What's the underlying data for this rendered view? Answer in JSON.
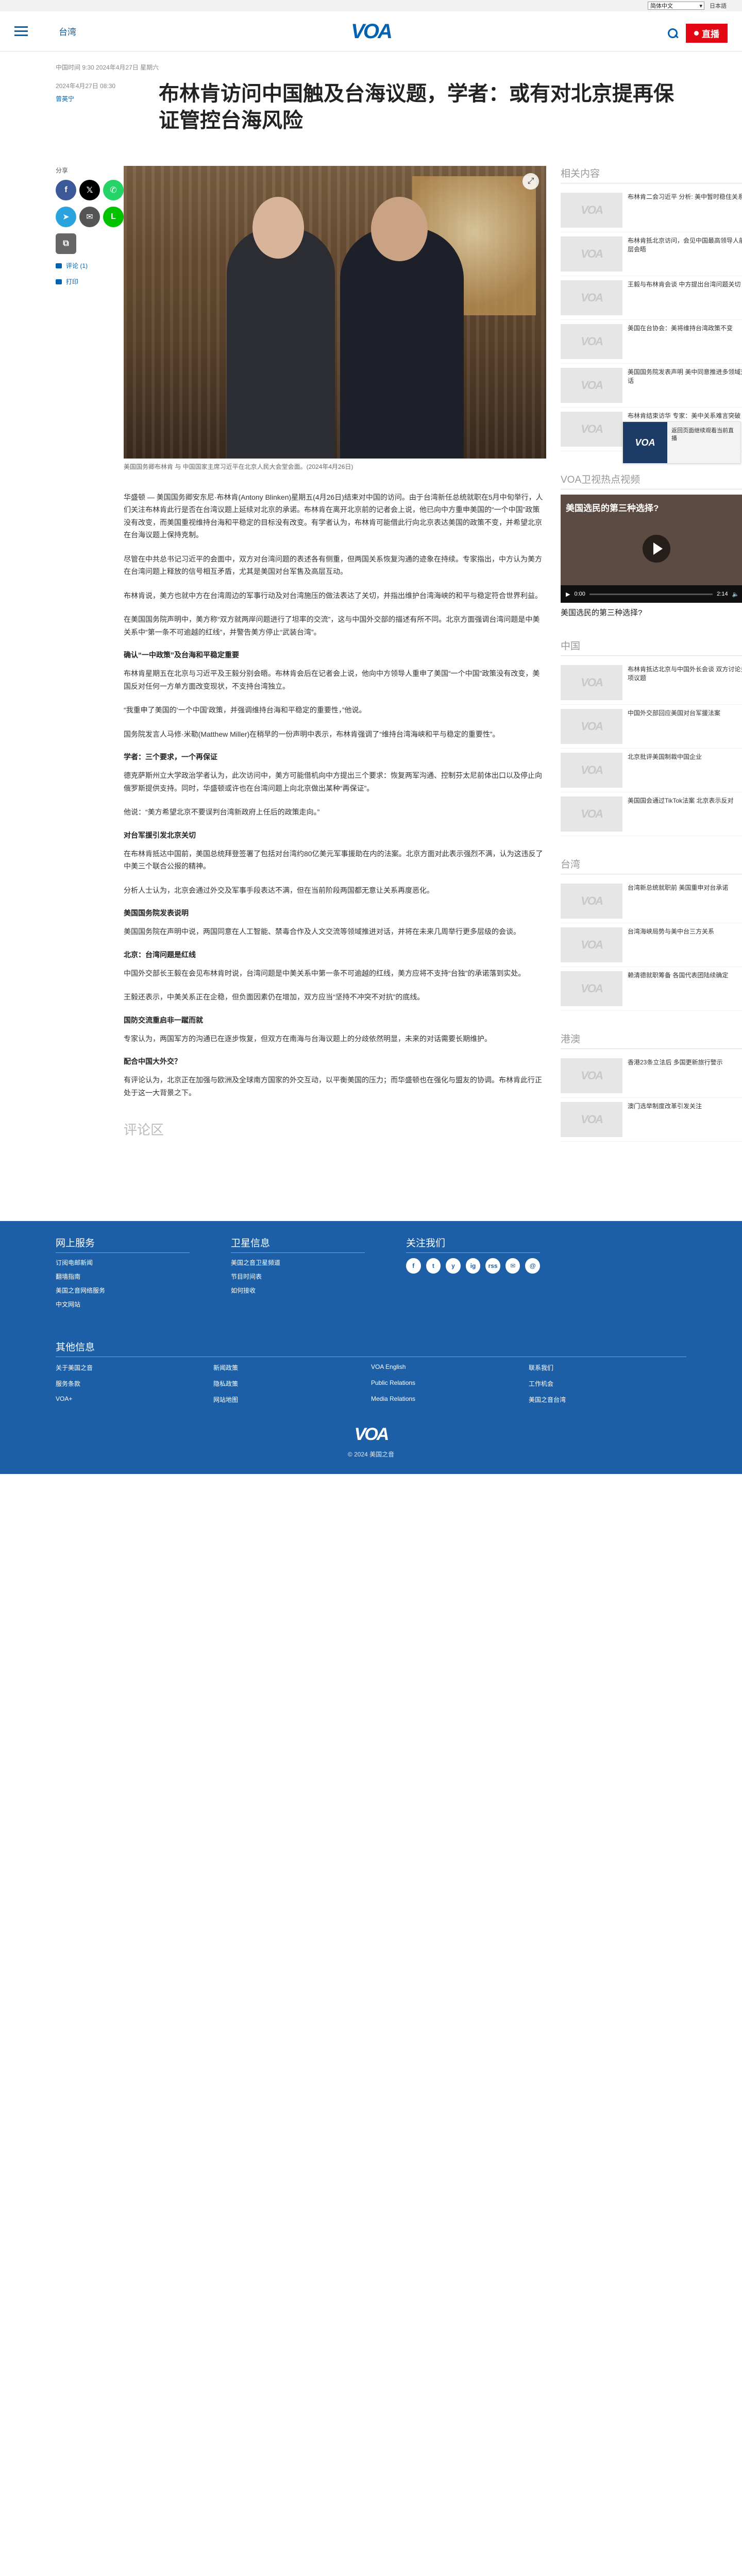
{
  "topbar": {
    "language": "简体中文",
    "external_link": "日本語"
  },
  "header": {
    "section": "台湾",
    "logo": "VOA",
    "live_label": "直播"
  },
  "article": {
    "updated": "中国时间 9:30 2024年4月27日 星期六",
    "date": "2024年4月27日 08:30",
    "author": "曾英宁",
    "title": "布林肯访问中国触及台海议题，学者：或有对北京提再保证管控台海风险",
    "caption": "美国国务卿布林肯 与 中国国家主席习近平在北京人民大会堂会面。(2024年4月26日)",
    "paragraphs": [
      "华盛顿 — 美国国务卿安东尼·布林肯(Antony Blinken)星期五(4月26日)结束对中国的访问。由于台湾新任总统就职在5月中旬举行，人们关注布林肯此行是否在台湾议题上延续对北京的承诺。布林肯在离开北京前的记者会上说，他已向中方重申美国的“一个中国”政策没有改变，而美国重视维持台海和平稳定的目标没有改变。有学者认为，布林肯可能借此行向北京表达美国的政策不变，并希望北京在台海议题上保持克制。",
      "尽管在中共总书记习近平的会面中，双方对台湾问题的表述各有侧重，但两国关系恢复沟通的迹象在持续。专家指出，中方认为美方在台湾问题上释放的信号相互矛盾，尤其是美国对台军售及高层互动。",
      "布林肯说，美方也就中方在台湾周边的军事行动及对台湾施压的做法表达了关切，并指出维护台湾海峡的和平与稳定符合世界利益。",
      "在美国国务院声明中，美方称“双方就两岸问题进行了坦率的交流”，这与中国外交部的描述有所不同。北京方面强调台湾问题是中美关系中“第一条不可逾越的红线”，并警告美方停止“武装台湾”。"
    ],
    "sections": [
      {
        "heading": "确认“一中政策”及台海和平稳定重要",
        "paragraphs": [
          "布林肯星期五在北京与习近平及王毅分别会晤。布林肯会后在记者会上说，他向中方领导人重申了美国“一个中国”政策没有改变，美国反对任何一方单方面改变现状，不支持台湾独立。",
          "“我重申了美国的‘一个中国’政策，并强调维持台海和平稳定的重要性，”他说。",
          "国务院发言人马修·米勒(Matthew Miller)在稍早的一份声明中表示，布林肯强调了“维持台湾海峡和平与稳定的重要性”。"
        ]
      },
      {
        "heading": "学者：三个要求，一个再保证",
        "paragraphs": [
          "德克萨斯州立大学政治学者认为，此次访问中，美方可能借机向中方提出三个要求：恢复两军沟通、控制芬太尼前体出口以及停止向俄罗斯提供支持。同时，华盛顿或许也在台湾问题上向北京做出某种“再保证”。",
          "他说：“美方希望北京不要误判台湾新政府上任后的政策走向。”"
        ]
      },
      {
        "heading": "对台军援引发北京关切",
        "paragraphs": [
          "在布林肯抵达中国前，美国总统拜登签署了包括对台湾约80亿美元军事援助在内的法案。北京方面对此表示强烈不满，认为这违反了中美三个联合公报的精神。",
          "分析人士认为，北京会通过外交及军事手段表达不满，但在当前阶段两国都无意让关系再度恶化。"
        ]
      },
      {
        "heading": "美国国务院发表说明",
        "paragraphs": [
          "美国国务院在声明中说，两国同意在人工智能、禁毒合作及人文交流等领域推进对话，并将在未来几周举行更多层级的会谈。"
        ]
      },
      {
        "heading": "北京：台湾问题是红线",
        "paragraphs": [
          "中国外交部长王毅在会见布林肯时说，台湾问题是中美关系中第一条不可逾越的红线，美方应将不支持“台独”的承诺落到实处。",
          "王毅还表示，中美关系正在企稳，但负面因素仍在增加，双方应当“坚持不冲突不对抗”的底线。"
        ]
      },
      {
        "heading": "国防交流重启非一蹴而就",
        "paragraphs": [
          "专家认为，两国军方的沟通已在逐步恢复，但双方在南海与台海议题上的分歧依然明显，未来的对话需要长期维护。"
        ]
      },
      {
        "heading": "配合中国大外交？",
        "paragraphs": [
          "有评论认为，北京正在加强与欧洲及全球南方国家的外交互动，以平衡美国的压力；而华盛顿也在强化与盟友的协调。布林肯此行正处于这一大背景之下。"
        ]
      }
    ]
  },
  "share": {
    "label": "分享",
    "comments": "评论 (1)",
    "print": "打印"
  },
  "sidebar": {
    "related": {
      "title": "相关内容",
      "items": [
        "布林肯二会习近平 分析: 美中暂时稳住关系",
        "布林肯抵北京访问，会见中国最高领导人前高层会晤",
        "王毅与布林肯会谈 中方提出台湾问题关切",
        "美国在台协会：美将维持台湾政策不变",
        "美国国务院发表声明 美中同意推进多领域对话",
        "布林肯结束访华 专家：美中关系难言突破"
      ]
    },
    "video": {
      "section_title": "VOA卫视热点视频",
      "overlay_title": "美国选民的第三种选择?",
      "time": "0:00",
      "duration": "2:14",
      "caption": "美国选民的第三种选择?"
    },
    "china": {
      "title": "中国",
      "items": [
        "布林肯抵达北京与中国外长会谈 双方讨论多项议题",
        "中国外交部回应美国对台军援法案",
        "北京批评美国制裁中国企业",
        "美国国会通过TikTok法案 北京表示反对"
      ]
    },
    "taiwan": {
      "title": "台湾",
      "items": [
        "台湾新总统就职前 美国重申对台承诺",
        "台湾海峡局势与美中台三方关系",
        "赖清德就职筹备 各国代表团陆续确定"
      ]
    },
    "hongkong": {
      "title": "港澳",
      "items": [
        "香港23条立法后 多国更新旅行警示",
        "澳门选举制度改革引发关注"
      ]
    }
  },
  "pip": {
    "text": "返回页面继续观看当前直播"
  },
  "footer": {
    "col1": {
      "title": "网上服务",
      "links": [
        "订阅电邮新闻",
        "翻墙指南",
        "美国之音网络服务",
        "中文网站"
      ]
    },
    "col2": {
      "title": "卫星信息",
      "links": [
        "美国之音卫星频道",
        "节目时间表",
        "如何接收"
      ]
    },
    "col3": {
      "title": "关注我们",
      "icons": [
        "f",
        "t",
        "y",
        "ig",
        "rss",
        "✉",
        "@"
      ]
    },
    "more_title": "其他信息",
    "more_links": [
      "关于美国之音",
      "新闻政策",
      "VOA English",
      "联系我们",
      "服务条款",
      "隐私政策",
      "Public Relations",
      "工作机会",
      "VOA+",
      "网站地图",
      "Media Relations",
      "美国之音台湾"
    ],
    "logo": "VOA",
    "copyright": "© 2024 美国之音"
  }
}
